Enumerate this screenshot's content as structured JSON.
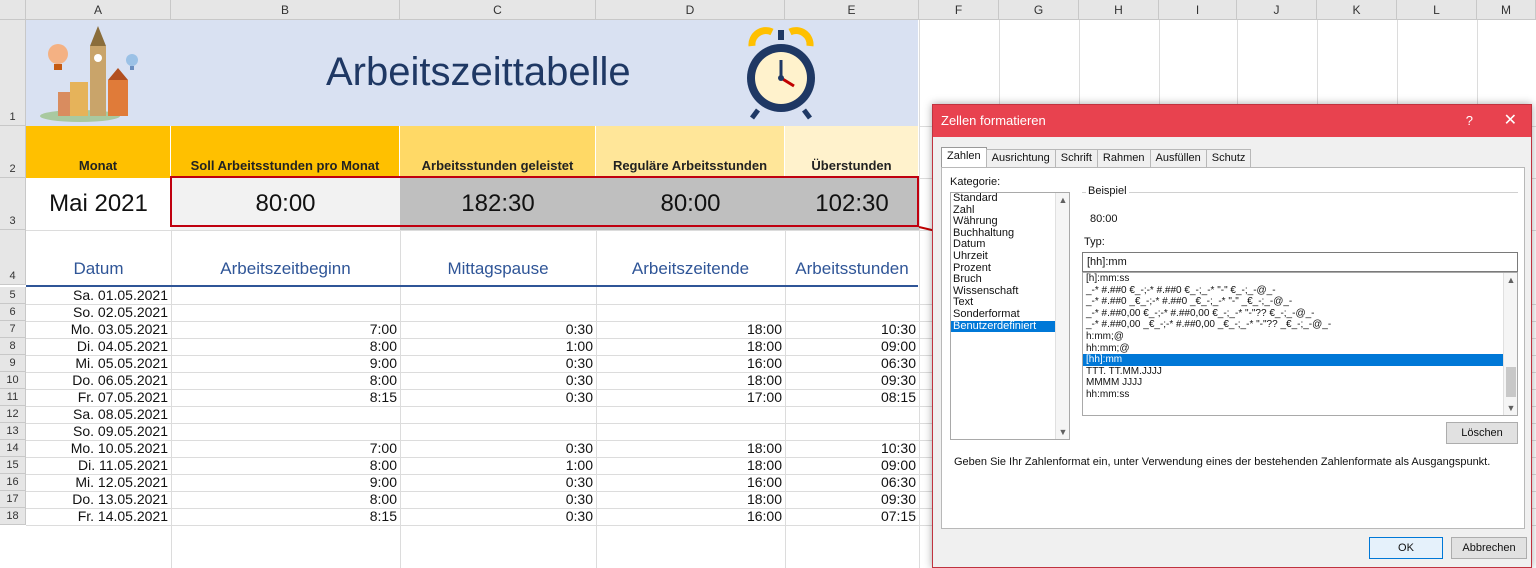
{
  "columns": [
    "A",
    "B",
    "C",
    "D",
    "E",
    "F",
    "G",
    "H",
    "I",
    "J",
    "K",
    "L",
    "M"
  ],
  "row_numbers": [
    "1",
    "2",
    "3",
    "4",
    "5",
    "6",
    "7",
    "8",
    "9",
    "10",
    "11",
    "12",
    "13",
    "14",
    "15",
    "16",
    "17",
    "18"
  ],
  "banner": {
    "title": "Arbeitszeittabelle"
  },
  "headers": {
    "monat": "Monat",
    "soll": "Soll Arbeitsstunden pro Monat",
    "geleistet": "Arbeitsstunden geleistet",
    "regulaer": "Reguläre Arbeitsstunden",
    "ueber": "Überstunden"
  },
  "values": {
    "monat": "Mai 2021",
    "soll": "80:00",
    "geleistet": "182:30",
    "regulaer": "80:00",
    "ueber": "102:30"
  },
  "labels": {
    "datum": "Datum",
    "beginn": "Arbeitszeitbeginn",
    "pause": "Mittagspause",
    "ende": "Arbeitszeitende",
    "stunden": "Arbeitsstunden"
  },
  "rows": [
    {
      "datum": "Sa. 01.05.2021",
      "beginn": "",
      "pause": "",
      "ende": "",
      "stunden": ""
    },
    {
      "datum": "So. 02.05.2021",
      "beginn": "",
      "pause": "",
      "ende": "",
      "stunden": ""
    },
    {
      "datum": "Mo. 03.05.2021",
      "beginn": "7:00",
      "pause": "0:30",
      "ende": "18:00",
      "stunden": "10:30"
    },
    {
      "datum": "Di. 04.05.2021",
      "beginn": "8:00",
      "pause": "1:00",
      "ende": "18:00",
      "stunden": "09:00"
    },
    {
      "datum": "Mi. 05.05.2021",
      "beginn": "9:00",
      "pause": "0:30",
      "ende": "16:00",
      "stunden": "06:30"
    },
    {
      "datum": "Do. 06.05.2021",
      "beginn": "8:00",
      "pause": "0:30",
      "ende": "18:00",
      "stunden": "09:30"
    },
    {
      "datum": "Fr. 07.05.2021",
      "beginn": "8:15",
      "pause": "0:30",
      "ende": "17:00",
      "stunden": "08:15"
    },
    {
      "datum": "Sa. 08.05.2021",
      "beginn": "",
      "pause": "",
      "ende": "",
      "stunden": ""
    },
    {
      "datum": "So. 09.05.2021",
      "beginn": "",
      "pause": "",
      "ende": "",
      "stunden": ""
    },
    {
      "datum": "Mo. 10.05.2021",
      "beginn": "7:00",
      "pause": "0:30",
      "ende": "18:00",
      "stunden": "10:30"
    },
    {
      "datum": "Di. 11.05.2021",
      "beginn": "8:00",
      "pause": "1:00",
      "ende": "18:00",
      "stunden": "09:00"
    },
    {
      "datum": "Mi. 12.05.2021",
      "beginn": "9:00",
      "pause": "0:30",
      "ende": "16:00",
      "stunden": "06:30"
    },
    {
      "datum": "Do. 13.05.2021",
      "beginn": "8:00",
      "pause": "0:30",
      "ende": "18:00",
      "stunden": "09:30"
    },
    {
      "datum": "Fr. 14.05.2021",
      "beginn": "8:15",
      "pause": "0:30",
      "ende": "16:00",
      "stunden": "07:15"
    }
  ],
  "dialog": {
    "title": "Zellen formatieren",
    "help": "?",
    "close": "✕",
    "tabs": [
      "Zahlen",
      "Ausrichtung",
      "Schrift",
      "Rahmen",
      "Ausfüllen",
      "Schutz"
    ],
    "kategorie_label": "Kategorie:",
    "kategorien": [
      "Standard",
      "Zahl",
      "Währung",
      "Buchhaltung",
      "Datum",
      "Uhrzeit",
      "Prozent",
      "Bruch",
      "Wissenschaft",
      "Text",
      "Sonderformat",
      "Benutzerdefiniert"
    ],
    "beispiel_label": "Beispiel",
    "beispiel_value": "80:00",
    "typ_label": "Typ:",
    "typ_value": "[hh]:mm",
    "typ_list": [
      "[h]:mm:ss",
      "_-* #.##0 €_-;-* #.##0 €_-;_-* \"-\" €_-;_-@_-",
      "_-* #.##0 _€_-;-* #.##0 _€_-;_-* \"-\" _€_-;_-@_-",
      "_-* #.##0,00 €_-;-* #.##0,00 €_-;_-* \"-\"?? €_-;_-@_-",
      "_-* #.##0,00 _€_-;-* #.##0,00 _€_-;_-* \"-\"?? _€_-;_-@_-",
      "h:mm;@",
      "hh:mm;@",
      "[hh]:mm",
      "TTT. TT.MM.JJJJ",
      "MMMM JJJJ",
      "hh:mm:ss"
    ],
    "loeschen": "Löschen",
    "description": "Geben Sie Ihr Zahlenformat ein, unter Verwendung eines der bestehenden Zahlenformate als Ausgangspunkt.",
    "ok": "OK",
    "cancel": "Abbrechen"
  },
  "colors": {
    "accent": "#e8424f",
    "header_gold": "#ffc000",
    "highlight_red": "#c0000f",
    "selection": "#0078d7"
  }
}
